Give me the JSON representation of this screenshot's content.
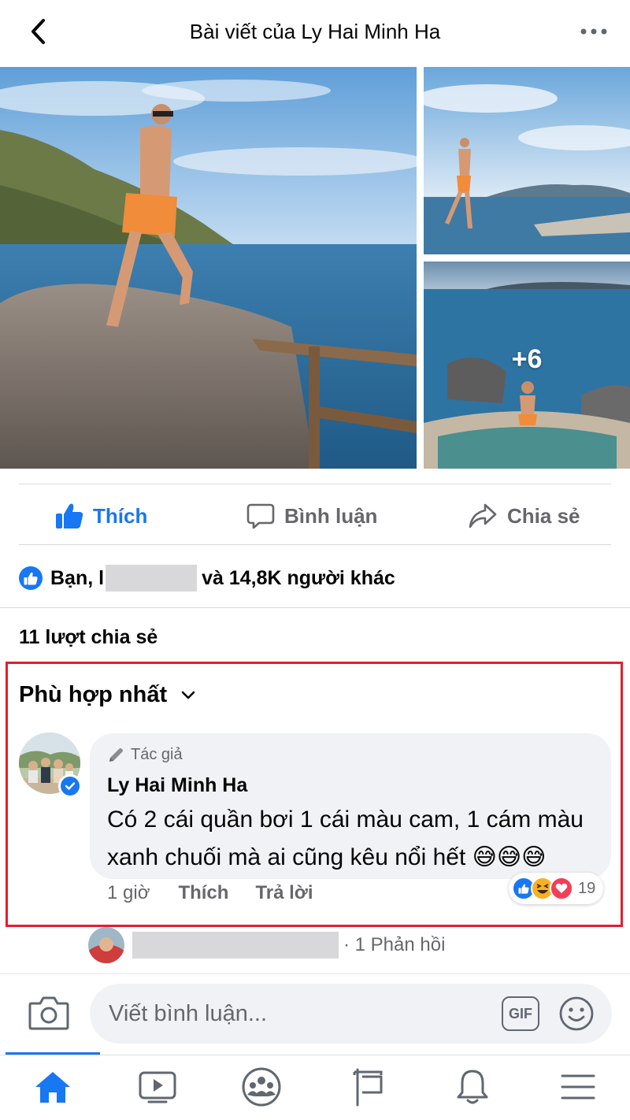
{
  "header": {
    "title": "Bài viết của Ly Hai Minh Ha"
  },
  "photos": {
    "more_count": "+6"
  },
  "actions": {
    "like": "Thích",
    "comment": "Bình luận",
    "share": "Chia sẻ"
  },
  "reactions": {
    "prefix": "Bạn, l",
    "suffix": "và 14,8K người khác"
  },
  "shares": {
    "text": "11 lượt chia sẻ"
  },
  "comments": {
    "sort_label": "Phù hợp nhất",
    "top": {
      "author_tag": "Tác giả",
      "author": "Ly Hai Minh Ha",
      "text": "Có 2 cái quần bơi 1 cái màu cam, 1 cám màu xanh chuối mà ai cũng kêu nổi hết 😅😅😅",
      "time": "1 giờ",
      "like": "Thích",
      "reply": "Trả lời",
      "reaction_count": "19",
      "reaction_icons": [
        "like-icon",
        "haha-icon",
        "love-icon"
      ]
    },
    "replies": {
      "text": "· 1 Phản hồi"
    }
  },
  "composer": {
    "placeholder": "Viết bình luận...",
    "gif": "GIF"
  },
  "tabs": [
    "home",
    "watch",
    "groups",
    "pages",
    "notifications",
    "menu"
  ],
  "colors": {
    "brand": "#1877f2",
    "highlight": "#e41e2b",
    "muted": "#65676b"
  }
}
